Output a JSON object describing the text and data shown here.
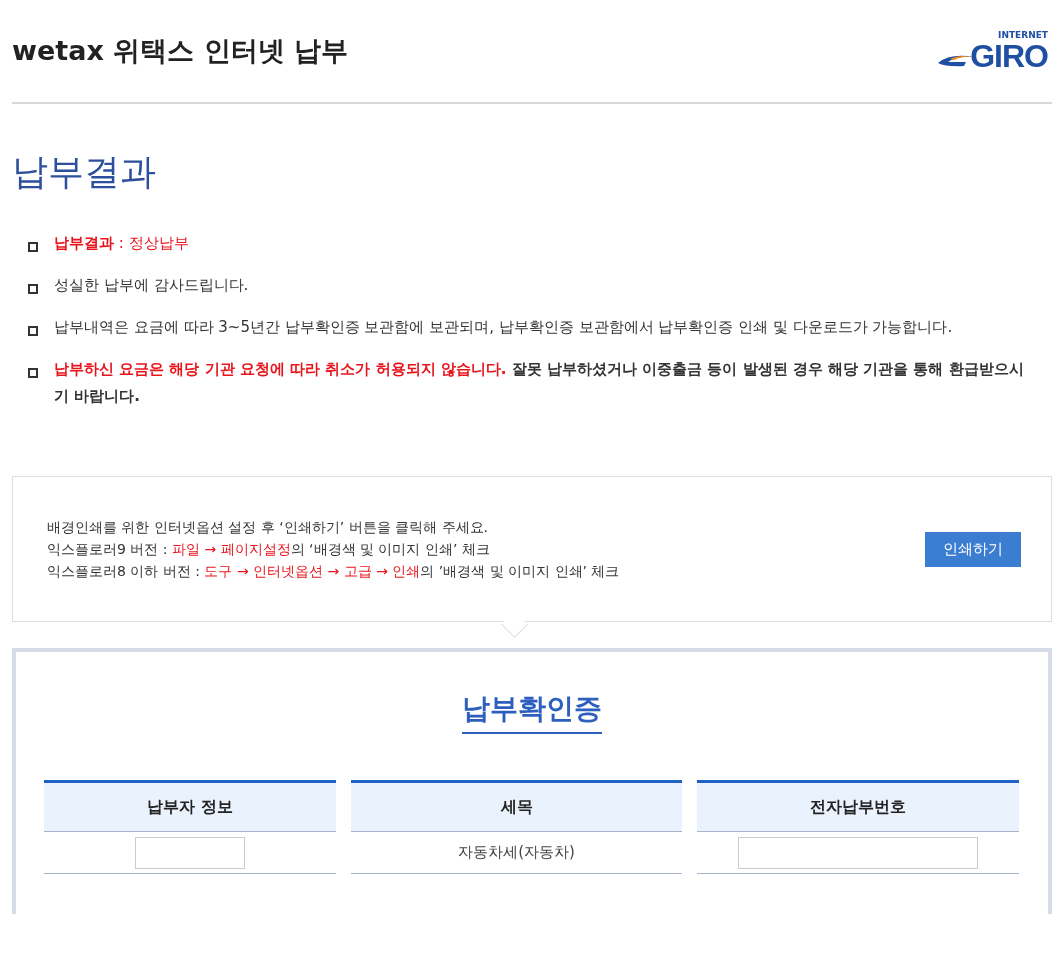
{
  "header": {
    "title": "wetax 위택스 인터넷 납부",
    "logo": {
      "small": "INTERNET",
      "big": "GIRO"
    }
  },
  "page_title": "납부결과",
  "notices": [
    {
      "segments": [
        {
          "text": "납부결과",
          "red": true,
          "bold": true
        },
        {
          "text": " : 정상납부",
          "red": true,
          "bold": false
        }
      ]
    },
    {
      "segments": [
        {
          "text": "성실한 납부에 감사드립니다.",
          "red": false,
          "bold": false
        }
      ]
    },
    {
      "segments": [
        {
          "text": "납부내역은 요금에 따라 3~5년간 납부확인증 보관함에 보관되며, 납부확인증 보관함에서 납부확인증 인쇄 및 다운로드가 가능합니다.",
          "red": false,
          "bold": false
        }
      ]
    },
    {
      "segments": [
        {
          "text": "납부하신 요금은 해당 기관 요청에 따라 취소가 허용되지 않습니다.",
          "red": true,
          "bold": true
        },
        {
          "text": " 잘못 납부하셨거나 이중출금 등이 발생된 경우 해당 기관을 통해 환급받으시기 바랍니다.",
          "red": false,
          "bold": true
        }
      ]
    }
  ],
  "print_box": {
    "lines": [
      {
        "segments": [
          {
            "text": "배경인쇄를 위한 인터넷옵션 설정 후 ‘인쇄하기’ 버튼을 클릭해 주세요.",
            "red": false
          }
        ]
      },
      {
        "segments": [
          {
            "text": "익스플로러9 버전 : ",
            "red": false
          },
          {
            "text": "파일 → 페이지설정",
            "red": true
          },
          {
            "text": "의 ‘배경색 및 이미지 인쇄’ 체크",
            "red": false
          }
        ]
      },
      {
        "segments": [
          {
            "text": "익스플로러8 이하 버전 : ",
            "red": false
          },
          {
            "text": "도구 → 인터넷옵션 → 고급 → 인쇄",
            "red": true
          },
          {
            "text": "의 ’배경색 및 이미지 인쇄’ 체크",
            "red": false
          }
        ]
      }
    ],
    "button": "인쇄하기"
  },
  "certificate": {
    "title": "납부확인증",
    "columns": [
      {
        "heading": "납부자 정보",
        "cell": {
          "kind": "field"
        }
      },
      {
        "heading": "세목",
        "cell": {
          "kind": "text",
          "text": "자동차세(자동차)"
        }
      },
      {
        "heading": "전자납부번호",
        "cell": {
          "kind": "wide-field"
        }
      }
    ]
  }
}
